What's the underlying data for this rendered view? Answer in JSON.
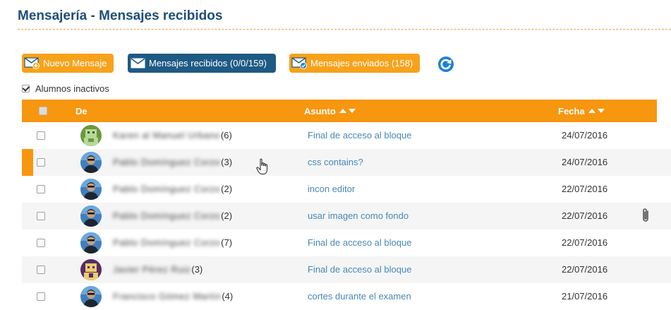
{
  "header": {
    "title": "Mensajería - Mensajes recibidos"
  },
  "toolbar": {
    "new_message": "Nuevo Mensaje",
    "received": "Mensajes recibidos (0/0/159)",
    "sent": "Mensajes enviados (158)"
  },
  "filter": {
    "inactive_label": "Alumnos inactivos",
    "inactive_checked": true
  },
  "table": {
    "columns": {
      "from": "De",
      "subject": "Asunto",
      "date": "Fecha"
    },
    "rows": [
      {
        "sender": "Karen al Manuel Urbano",
        "count": "(6)",
        "subject": "Final de acceso al bloque",
        "date": "24/07/2016",
        "avatar": "green-pixel",
        "attachment": false,
        "highlight": false
      },
      {
        "sender": "Pablo Domínguez Corzo",
        "count": "(3)",
        "subject": "css contains?",
        "date": "24/07/2016",
        "avatar": "photo",
        "attachment": false,
        "highlight": true
      },
      {
        "sender": "Pablo Domínguez Corzo",
        "count": "(2)",
        "subject": "incon editor",
        "date": "22/07/2016",
        "avatar": "photo",
        "attachment": false,
        "highlight": false
      },
      {
        "sender": "Pablo Domínguez Corzo",
        "count": "(2)",
        "subject": "usar imagen como fondo",
        "date": "22/07/2016",
        "avatar": "photo",
        "attachment": true,
        "highlight": false
      },
      {
        "sender": "Pablo Domínguez Corzo",
        "count": "(7)",
        "subject": "Final de acceso al bloque",
        "date": "22/07/2016",
        "avatar": "photo",
        "attachment": false,
        "highlight": false
      },
      {
        "sender": "Javier Pérez Ruiz",
        "count": "(3)",
        "subject": "Final de acceso al bloque",
        "date": "22/07/2016",
        "avatar": "purple-pixel",
        "attachment": false,
        "highlight": false
      },
      {
        "sender": "Francisco Gómez Martín",
        "count": "(4)",
        "subject": "cortes durante el examen",
        "date": "21/07/2016",
        "avatar": "photo",
        "attachment": false,
        "highlight": false
      }
    ]
  },
  "colors": {
    "accent": "#f7960f",
    "title": "#1f4e79",
    "link": "#4a87b5",
    "active_button": "#1e5a84"
  }
}
